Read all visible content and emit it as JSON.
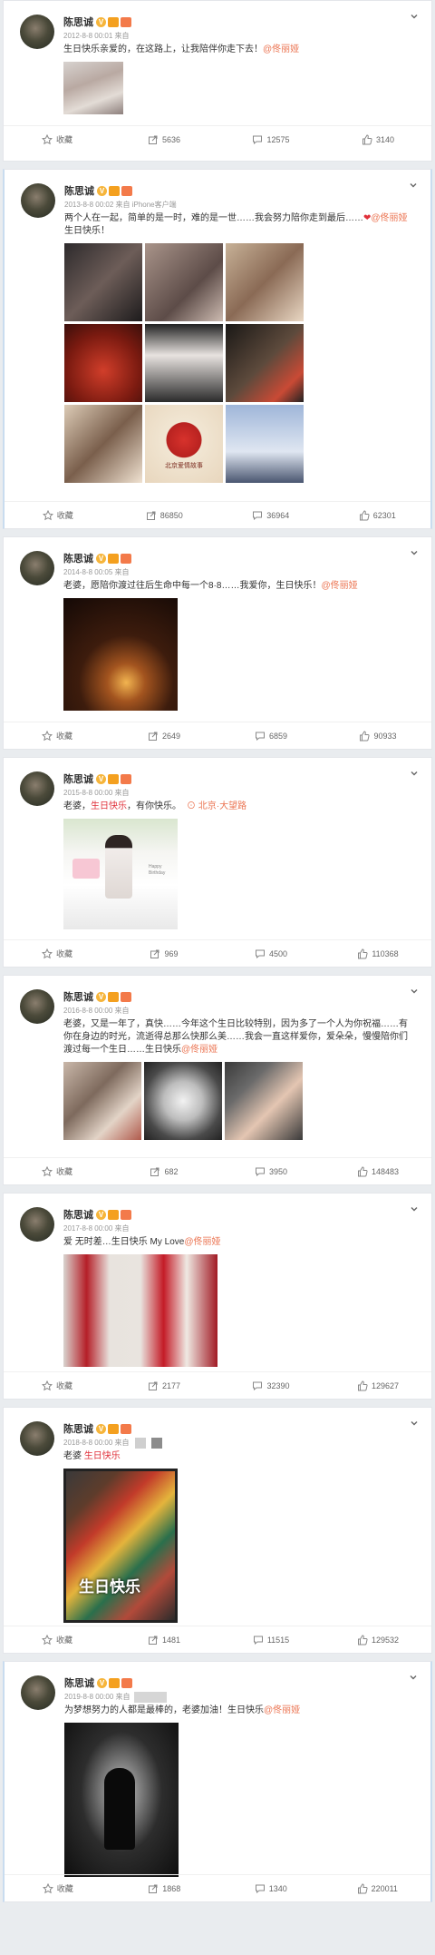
{
  "colors": {
    "accent": "#eb7350",
    "name": "#333333",
    "muted": "#999999",
    "red": "#e0303a"
  },
  "user": {
    "name": "陈思诚",
    "vbadge": "V"
  },
  "posts": [
    {
      "time": "2012-8-8 00:01 来自",
      "text": "生日快乐亲爱的，在这路上，让我陪伴你走下去！",
      "mention": "@佟丽娅",
      "actions": {
        "fav": "收藏",
        "repost": "5636",
        "comment": "12575",
        "like": "3140"
      }
    },
    {
      "time": "2013-8-8 00:02 来自 iPhone客户端",
      "text": "两个人在一起，简单的是一时，难的是一世……我会努力陪你走到最后……",
      "mention": "@佟丽娅",
      "text2": " 生日快乐！",
      "actions": {
        "fav": "收藏",
        "repost": "86850",
        "comment": "36964",
        "like": "62301"
      }
    },
    {
      "time": "2014-8-8 00:05 来自",
      "text": "老婆，愿陪你渡过往后生命中每一个8·8……我爱你，生日快乐！",
      "mention": "@佟丽娅",
      "actions": {
        "fav": "收藏",
        "repost": "2649",
        "comment": "6859",
        "like": "90933"
      }
    },
    {
      "time": "2015-8-8 00:00 来自",
      "text": "老婆，",
      "red": "生日快乐",
      "text2": "，有你快乐。",
      "location": "北京·大望路",
      "actions": {
        "fav": "收藏",
        "repost": "969",
        "comment": "4500",
        "like": "110368"
      }
    },
    {
      "time": "2016-8-8 00:00 来自",
      "text": "老婆，又是一年了，真快……今年这个生日比较特别，因为多了一个人为你祝福……有你在身边的时光，流逝得总那么快那么美……我会一直这样爱你，爱朵朵，慢慢陪你们渡过每一个生日……生日快乐",
      "mention": "@佟丽娅",
      "actions": {
        "fav": "收藏",
        "repost": "682",
        "comment": "3950",
        "like": "148483"
      }
    },
    {
      "time": "2017-8-8 00:00 来自",
      "text": "爱 无时差…生日快乐 My Love",
      "mention": "@佟丽娅",
      "actions": {
        "fav": "收藏",
        "repost": "2177",
        "comment": "32390",
        "like": "129627"
      }
    },
    {
      "time": "2018-8-8 00:00 来自",
      "text": "老婆 ",
      "red": "生日快乐",
      "card_text": "生日快乐",
      "actions": {
        "fav": "收藏",
        "repost": "1481",
        "comment": "11515",
        "like": "129532"
      }
    },
    {
      "time": "2019-8-8 00:00 来自",
      "text": "为梦想努力的人都是最棒的，老婆加油！生日快乐",
      "mention": "@佟丽娅",
      "actions": {
        "fav": "收藏",
        "repost": "1868",
        "comment": "1340",
        "like": "220011"
      }
    }
  ],
  "photo_texts": {
    "p4_cake": "Happy Birthday",
    "p2_heart": "北京爱情故事"
  }
}
